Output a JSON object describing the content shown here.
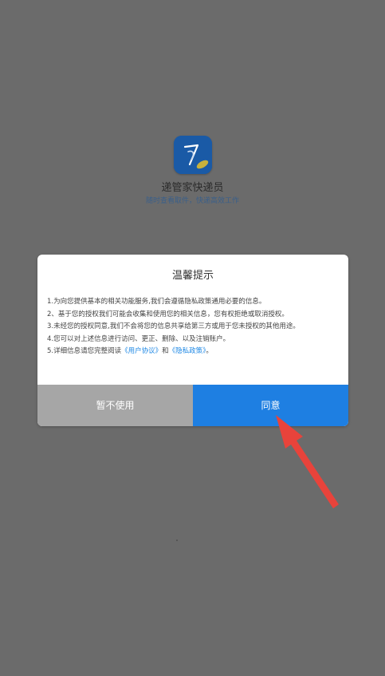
{
  "app": {
    "name": "递管家快递员",
    "slogan": "随时查看取件，快递高效工作",
    "logo_icon": "app-logo-icon"
  },
  "dialog": {
    "title": "温馨提示",
    "lines": [
      "1.为向您提供基本的相关功能服务,我们会遵循隐私政策通用必要的信息。",
      "2、基于您的授权我们可能会收集和使用您的相关信息，您有权拒绝或取消授权。",
      "3.未经您的授权同意,我们不会将您的信息共享给第三方或用于您未授权的其他用途。",
      "4.您可以对上述信息进行访问、更正、删除、以及注销账户。"
    ],
    "line5": {
      "prefix": "5.详细信息请您完整阅读",
      "user_agreement_link": "《用户协议》",
      "and": "和",
      "privacy_policy_link": "《隐私政策》",
      "suffix": "。"
    },
    "buttons": {
      "reject": "暂不使用",
      "agree": "同意"
    }
  },
  "colors": {
    "background": "#6b6b6b",
    "agree_button": "#1e7fe2",
    "reject_button": "#a6a6a6",
    "link": "#1e88e5",
    "annotation_arrow": "#e8433b"
  }
}
